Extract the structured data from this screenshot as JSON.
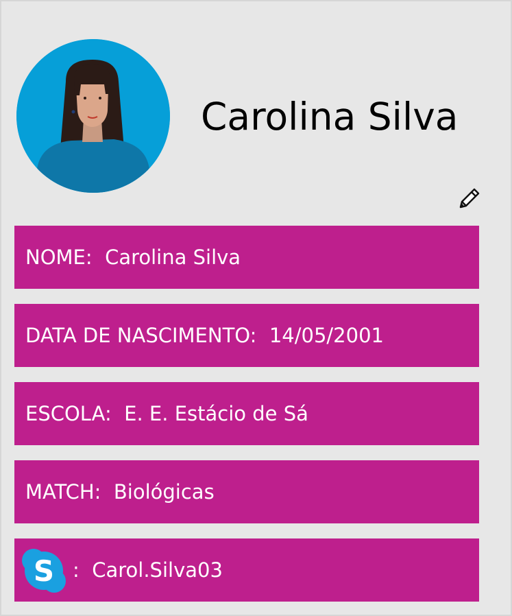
{
  "profile": {
    "name": "Carolina Silva",
    "avatar_icon": "woman-avatar-icon"
  },
  "actions": {
    "edit_icon": "pencil-icon"
  },
  "fields": [
    {
      "label": "NOME:",
      "value": "Carolina Silva"
    },
    {
      "label": "DATA DE NASCIMENTO:",
      "value": "14/05/2001"
    },
    {
      "label": "ESCOLA:",
      "value": "E. E. Estácio de Sá"
    },
    {
      "label": "MATCH:",
      "value": "Biológicas"
    }
  ],
  "skype": {
    "icon": "skype-icon",
    "separator": ":",
    "handle": "Carol.Silva03"
  },
  "colors": {
    "background": "#e7e7e7",
    "field_background": "#be1f8d",
    "field_text": "#ffffff",
    "avatar_background": "#069fd8"
  }
}
